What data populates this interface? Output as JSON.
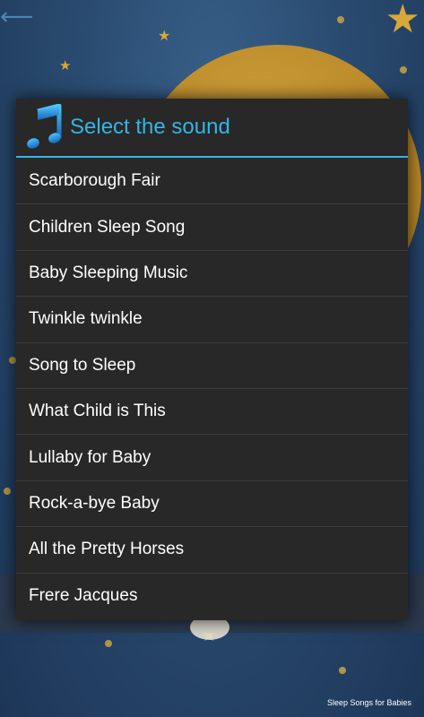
{
  "dialog": {
    "title": "Select the sound",
    "header_icon": "music-note-icon",
    "accent_color": "#33b5e5",
    "items": [
      {
        "label": "Scarborough Fair"
      },
      {
        "label": "Children Sleep Song"
      },
      {
        "label": "Baby Sleeping Music"
      },
      {
        "label": "Twinkle twinkle"
      },
      {
        "label": "Song to Sleep"
      },
      {
        "label": "What Child is This"
      },
      {
        "label": "Lullaby for Baby"
      },
      {
        "label": "Rock-a-bye Baby"
      },
      {
        "label": "All the Pretty Horses"
      },
      {
        "label": "Frere Jacques"
      }
    ]
  },
  "background": {
    "caption": "Sleep Songs for Babies",
    "back_icon": "arrow-left-icon",
    "star_icon": "star-icon"
  }
}
